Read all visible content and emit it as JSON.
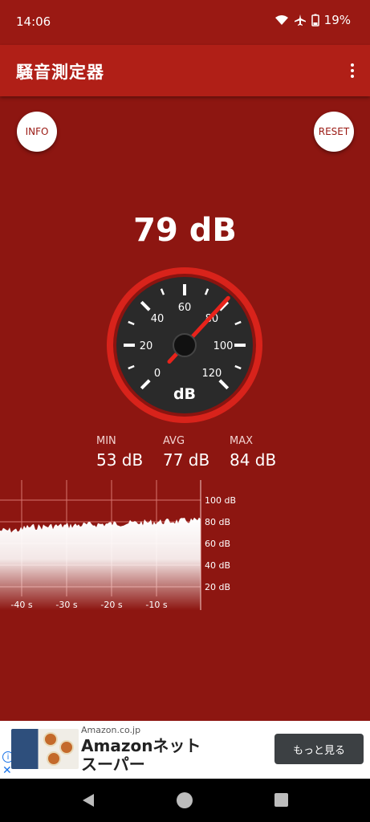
{
  "status_bar": {
    "time": "14:06",
    "battery": "19%"
  },
  "app": {
    "title": "騒音測定器"
  },
  "buttons": {
    "info": "INFO",
    "reset": "RESET"
  },
  "reading": {
    "current": "79 dB",
    "current_value": 79
  },
  "gauge": {
    "unit": "dB",
    "ticks": [
      "0",
      "20",
      "40",
      "60",
      "80",
      "100",
      "120"
    ],
    "min_value": 0,
    "max_value": 120,
    "needle_value": 79
  },
  "stats": {
    "min": {
      "label": "MIN",
      "value": "53 dB"
    },
    "avg": {
      "label": "AVG",
      "value": "77 dB"
    },
    "max": {
      "label": "MAX",
      "value": "84 dB"
    }
  },
  "history_graph": {
    "y_labels": [
      "100 dB",
      "80 dB",
      "60 dB",
      "40 dB",
      "20 dB"
    ],
    "x_labels": [
      "-40 s",
      "-30 s",
      "-20 s",
      "-10 s"
    ]
  },
  "ad": {
    "source": "Amazon.co.jp",
    "headline_line1": "Amazonネット",
    "headline_line2": "スーパー",
    "cta": "もっと見る",
    "info_icon": "i",
    "close_icon": "✕"
  },
  "colors": {
    "background": "#8d1611",
    "app_bar": "#b01f17",
    "gauge_ring": "#d8231b",
    "needle": "#e8231b"
  }
}
